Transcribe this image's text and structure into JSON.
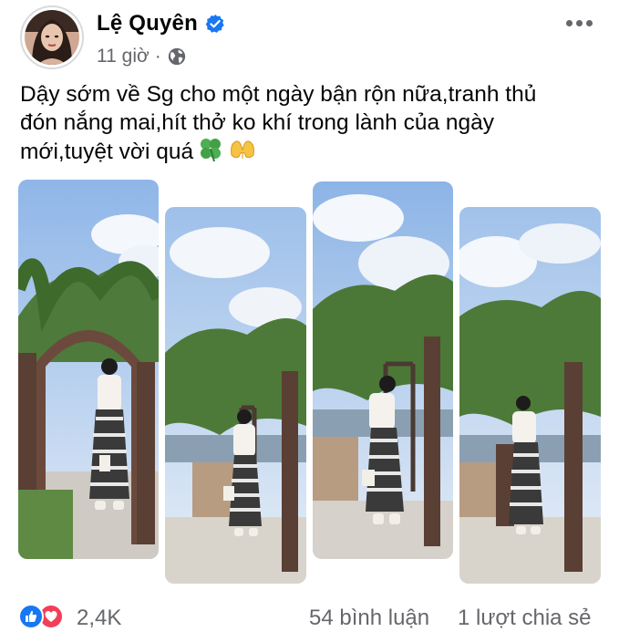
{
  "post": {
    "author": "Lệ Quyên",
    "time": "11 giờ",
    "separator": "·",
    "caption_lines": [
      "Dậy sớm về Sg cho một ngày bận rộn nữa,tranh thủ",
      "đón nắng mai,hít thở ko khí trong lành của ngày",
      "mới,tuyệt vời quá"
    ],
    "caption_emojis": [
      "four-leaf-clover-emoji",
      "heart-hands-emoji"
    ]
  },
  "icons": {
    "verified": "verified-badge-icon",
    "audience": "globe-icon",
    "more": "more-options-icon",
    "like": "like-reaction-icon",
    "love": "love-reaction-icon"
  },
  "colors": {
    "accent": "#1877f2",
    "love": "#f33e58",
    "secondary_text": "#65676b"
  },
  "footer": {
    "reaction_count": "2,4K",
    "comments": "54 bình luận",
    "shares": "1 lượt chia sẻ"
  }
}
